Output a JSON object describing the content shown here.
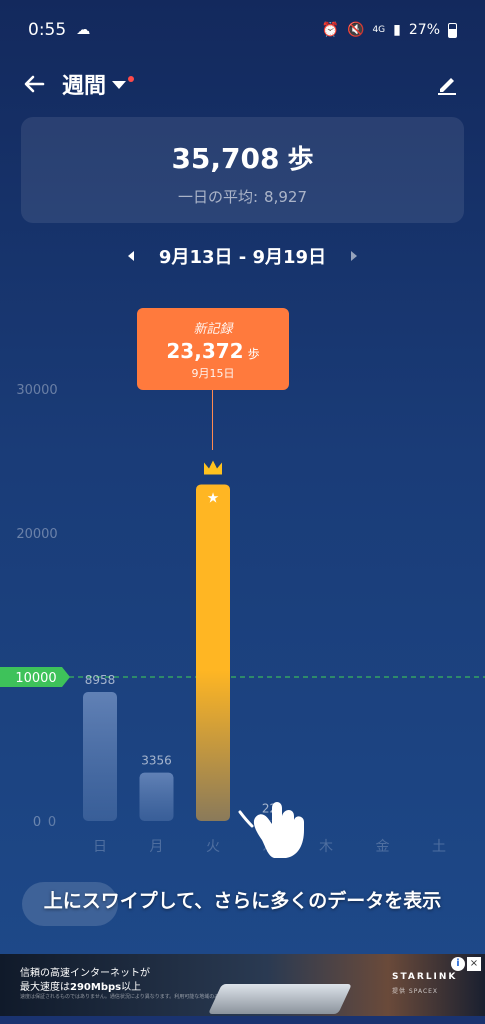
{
  "status_bar": {
    "time": "0:55",
    "battery": "27%",
    "network": "4G"
  },
  "header": {
    "title": "週間"
  },
  "summary": {
    "total": "35,708",
    "unit": "歩",
    "avg_label": "一日の平均:",
    "avg_value": "8,927"
  },
  "date_range": "9月13日 - 9月19日",
  "tooltip": {
    "label": "新記録",
    "value": "23,372",
    "unit": "歩",
    "date": "9月15日"
  },
  "chart_data": {
    "type": "bar",
    "categories": [
      "日",
      "月",
      "火",
      "水",
      "木",
      "金",
      "土"
    ],
    "values": [
      8958,
      3356,
      23372,
      22,
      0,
      0,
      0
    ],
    "value_labels": [
      "8958",
      "3356",
      "",
      "22",
      "",
      "",
      ""
    ],
    "y_ticks": [
      "0",
      "10000",
      "20000",
      "30000"
    ],
    "ylim": [
      0,
      30000
    ],
    "goal": 10000,
    "goal_label": "10000",
    "highlight_index": 2,
    "colors": {
      "bar": "#4b6fa6",
      "highlight_top": "#ffb623",
      "highlight_bottom": "#8a7a5a",
      "goal": "#3ec25a"
    }
  },
  "overlay_hint": "上にスワイプして、さらに多くのデータを表示",
  "ad": {
    "line1": "信頼の高速インターネットが",
    "line2_prefix": "最大速度は",
    "line2_bold": "290Mbps",
    "line2_suffix": "以上",
    "fine_print": "速度は保証されるものではありません。通信状況により異なります。利用可能な地域のみ。",
    "brand": "STARLINK",
    "sub_brand": "提供  SPACEX",
    "info": "i",
    "close": "×"
  }
}
